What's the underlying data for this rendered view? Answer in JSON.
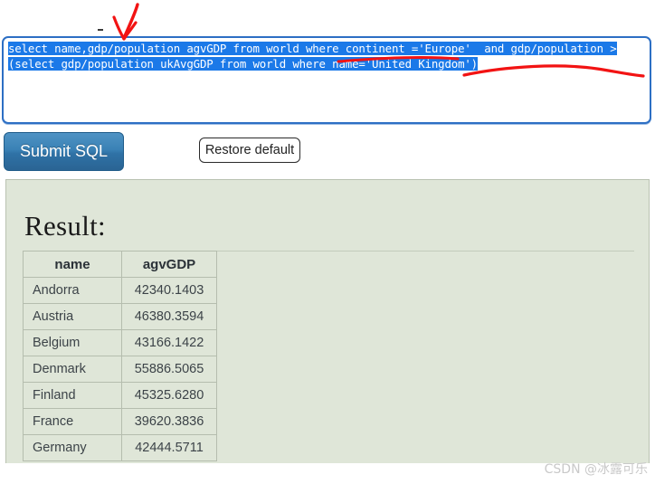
{
  "editor": {
    "name": "sql-query-textarea",
    "selected_text": "select name,gdp/population agvGDP from world where continent ='Europe'  and gdp/population >(select gdp/population ukAvgGDP from world where name='United Kingdom')",
    "selection_highlight_color": "#1b79e8",
    "border_color": "#2d6fc4"
  },
  "buttons": {
    "submit_label": "Submit SQL",
    "submit_color": "#3a81b5",
    "restore_label": "Restore default"
  },
  "result": {
    "title": "Result:",
    "panel_color": "#dfe6d8",
    "columns": [
      "name",
      "agvGDP"
    ],
    "rows": [
      [
        "Andorra",
        "42340.1403"
      ],
      [
        "Austria",
        "46380.3594"
      ],
      [
        "Belgium",
        "43166.1422"
      ],
      [
        "Denmark",
        "55886.5065"
      ],
      [
        "Finland",
        "45325.6280"
      ],
      [
        "France",
        "39620.3836"
      ],
      [
        "Germany",
        "42444.5711"
      ]
    ]
  },
  "annotations": {
    "color": "#f21313",
    "marks": [
      "down-arrow",
      "underline-stroke",
      "curve-stroke"
    ]
  },
  "watermark": {
    "text": "CSDN @冰露可乐"
  }
}
